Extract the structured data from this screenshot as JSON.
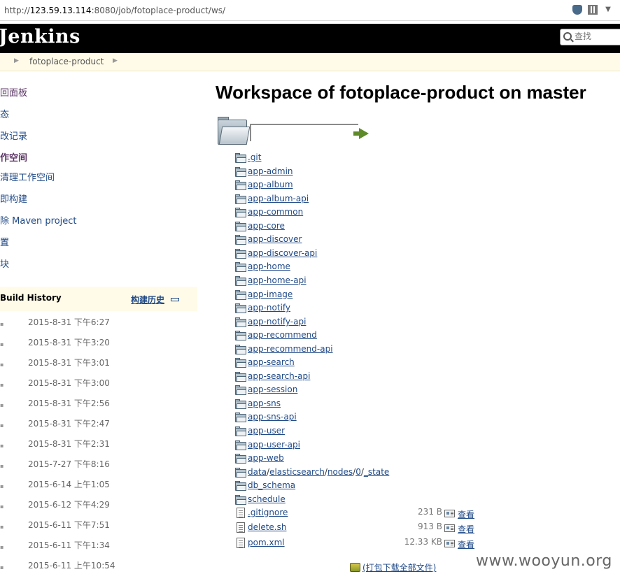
{
  "browser": {
    "url_prefix": "http://",
    "url_host": "123.59.13.114",
    "url_rest": ":8080/job/fotoplace-product/ws/"
  },
  "header": {
    "logo": "Jenkins",
    "search_placeholder": "查找"
  },
  "breadcrumb": {
    "project": "fotoplace-product"
  },
  "sidebar": {
    "tasks": [
      {
        "label": "回面板",
        "state": "visited"
      },
      {
        "label": "态",
        "state": "normal"
      },
      {
        "label": "改记录",
        "state": "normal"
      },
      {
        "label": "作空间",
        "state": "active"
      },
      {
        "label": "清理工作空间",
        "state": "normal"
      },
      {
        "label": "即构建",
        "state": "normal"
      },
      {
        "label": "除 Maven project",
        "state": "normal"
      },
      {
        "label": "置",
        "state": "normal"
      },
      {
        "label": "块",
        "state": "normal"
      }
    ],
    "build_history": {
      "title": "Build History",
      "trend_label": "构建历史",
      "builds": [
        "2015-8-31 下午6:27",
        "2015-8-31 下午3:20",
        "2015-8-31 下午3:01",
        "2015-8-31 下午3:00",
        "2015-8-31 下午2:56",
        "2015-8-31 下午2:47",
        "2015-8-31 下午2:31",
        "2015-7-27 下午8:16",
        "2015-6-14 上午1:05",
        "2015-6-12 下午4:29",
        "2015-6-11 下午7:51",
        "2015-6-11 下午1:34",
        "2015-6-11 上午10:54"
      ]
    }
  },
  "main": {
    "title": "Workspace of fotoplace-product on master",
    "folders": [
      ".git",
      "app-admin",
      "app-album",
      "app-album-api",
      "app-common",
      "app-core",
      "app-discover",
      "app-discover-api",
      "app-home",
      "app-home-api",
      "app-image",
      "app-notify",
      "app-notify-api",
      "app-recommend",
      "app-recommend-api",
      "app-search",
      "app-search-api",
      "app-session",
      "app-sns",
      "app-sns-api",
      "app-user",
      "app-user-api",
      "app-web"
    ],
    "deep_path": [
      "data",
      "elasticsearch",
      "nodes",
      "0",
      "_state"
    ],
    "folders_after": [
      "db_schema",
      "schedule"
    ],
    "files": [
      {
        "name": ".gitignore",
        "size": "231 B",
        "view": "查看"
      },
      {
        "name": "delete.sh",
        "size": "913 B",
        "view": "查看"
      },
      {
        "name": "pom.xml",
        "size": "12.33 KB",
        "view": "查看"
      }
    ],
    "zip_label": "(打包下载全部文件)"
  },
  "watermark": "www.wooyun.org"
}
